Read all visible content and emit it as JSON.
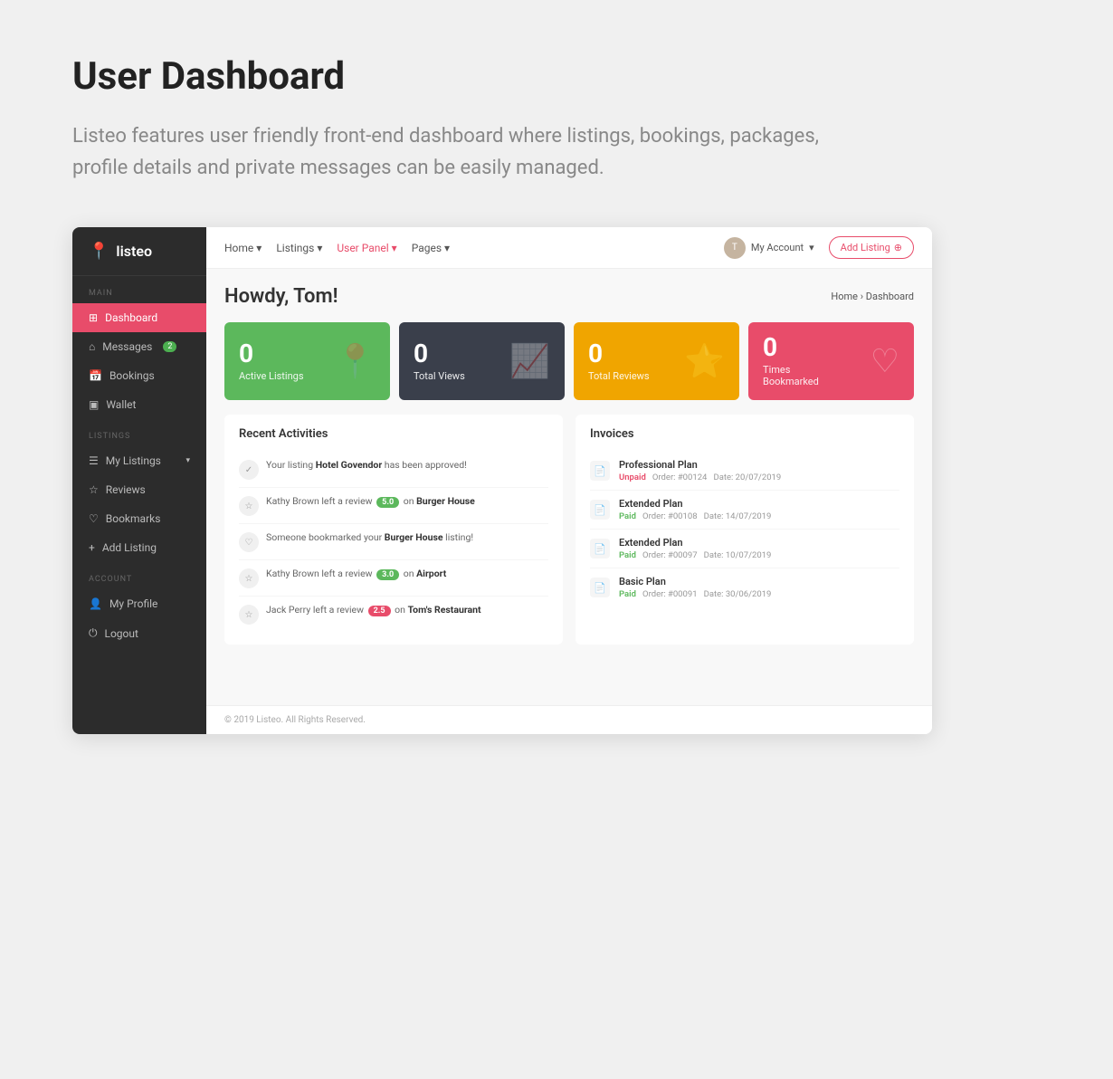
{
  "page": {
    "title": "User Dashboard",
    "description": "Listeo features user friendly front-end dashboard where listings, bookings, packages, profile details and private messages can be easily managed."
  },
  "logo": {
    "text": "listeo"
  },
  "sidebar": {
    "sections": [
      {
        "label": "MAIN",
        "items": [
          {
            "id": "dashboard",
            "label": "Dashboard",
            "icon": "⊞",
            "active": true
          },
          {
            "id": "messages",
            "label": "Messages",
            "icon": "⌂",
            "badge": "2"
          },
          {
            "id": "bookings",
            "label": "Bookings",
            "icon": "📅"
          },
          {
            "id": "wallet",
            "label": "Wallet",
            "icon": "▣"
          }
        ]
      },
      {
        "label": "LISTINGS",
        "items": [
          {
            "id": "my-listings",
            "label": "My Listings",
            "icon": "☰",
            "hasArrow": true
          },
          {
            "id": "reviews",
            "label": "Reviews",
            "icon": "☆"
          },
          {
            "id": "bookmarks",
            "label": "Bookmarks",
            "icon": "♡"
          },
          {
            "id": "add-listing",
            "label": "Add Listing",
            "icon": "+"
          }
        ]
      },
      {
        "label": "ACCOUNT",
        "items": [
          {
            "id": "my-profile",
            "label": "My Profile",
            "icon": "👤"
          },
          {
            "id": "logout",
            "label": "Logout",
            "icon": "⏻"
          }
        ]
      }
    ]
  },
  "navbar": {
    "links": [
      {
        "label": "Home",
        "hasArrow": true,
        "active": false
      },
      {
        "label": "Listings",
        "hasArrow": true,
        "active": false
      },
      {
        "label": "User Panel",
        "hasArrow": true,
        "active": true
      },
      {
        "label": "Pages",
        "hasArrow": true,
        "active": false
      }
    ],
    "account_label": "My Account",
    "add_listing_label": "Add Listing"
  },
  "dashboard": {
    "greeting": "Howdy, Tom!",
    "breadcrumb_home": "Home",
    "breadcrumb_current": "Dashboard",
    "stats": [
      {
        "number": "0",
        "label": "Active Listings",
        "color": "green",
        "icon": "📍"
      },
      {
        "number": "0",
        "label": "Total Views",
        "color": "dark",
        "icon": "📈"
      },
      {
        "number": "0",
        "label": "Total Reviews",
        "color": "orange",
        "icon": "⭐"
      },
      {
        "number": "0",
        "label": "Times\nBookmarked",
        "color": "red",
        "icon": "♡"
      }
    ]
  },
  "activities": {
    "title": "Recent Activities",
    "items": [
      {
        "type": "check",
        "text": "Your listing ",
        "highlight": "Hotel Govendor",
        "suffix": " has been approved!"
      },
      {
        "type": "star",
        "text": "Kathy Brown left a review ",
        "badge": "5.0",
        "badge_color": "green",
        "suffix": " on ",
        "place": "Burger House"
      },
      {
        "type": "heart",
        "text": "Someone bookmarked your ",
        "highlight": "Burger House",
        "suffix": " listing!"
      },
      {
        "type": "star",
        "text": "Kathy Brown left a review ",
        "badge": "3.0",
        "badge_color": "green",
        "suffix": " on ",
        "place": "Airport"
      },
      {
        "type": "star",
        "text": "Jack Perry left a review ",
        "badge": "2.5",
        "badge_color": "red",
        "suffix": " on ",
        "place": "Tom's Restaurant"
      }
    ]
  },
  "invoices": {
    "title": "Invoices",
    "items": [
      {
        "name": "Professional Plan",
        "status": "Unpaid",
        "status_type": "unpaid",
        "order": "Order: #00124",
        "date": "Date: 20/07/2019"
      },
      {
        "name": "Extended Plan",
        "status": "Paid",
        "status_type": "paid",
        "order": "Order: #00108",
        "date": "Date: 14/07/2019"
      },
      {
        "name": "Extended Plan",
        "status": "Paid",
        "status_type": "paid",
        "order": "Order: #00097",
        "date": "Date: 10/07/2019"
      },
      {
        "name": "Basic Plan",
        "status": "Paid",
        "status_type": "paid",
        "order": "Order: #00091",
        "date": "Date: 30/06/2019"
      }
    ]
  },
  "footer": {
    "text": "© 2019 Listeo. All Rights Reserved."
  }
}
